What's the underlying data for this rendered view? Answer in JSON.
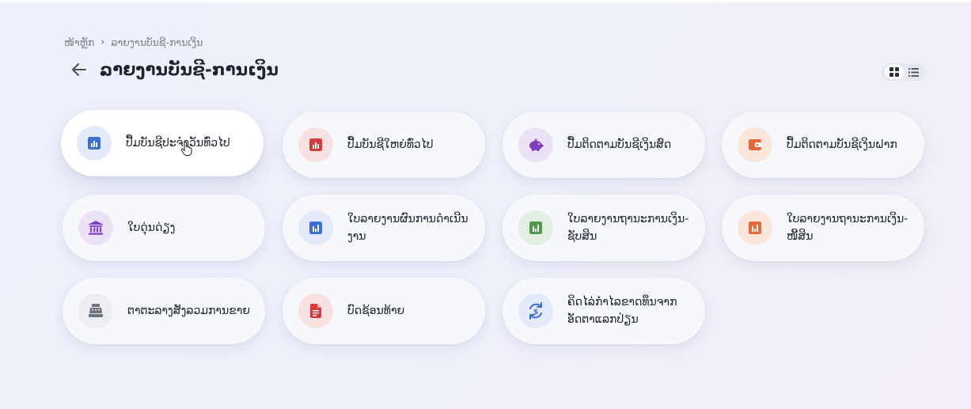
{
  "breadcrumb": {
    "home": "ໜ້າຫຼັກ",
    "current": "ລາຍງານບັນຊີ-ການເງິນ"
  },
  "page": {
    "title": "ລາຍງານບັນຊີ-ການເງິນ"
  },
  "cards": [
    {
      "label": "ປື້ມບັນຊີປະຈໍາວັນທົ່ວໄປ"
    },
    {
      "label": "ປື້ມບັນຊີໃຫຍ່ທົ່ວໄປ"
    },
    {
      "label": "ປື້ມຕິດຕາມບັນຊີເງິນສົດ"
    },
    {
      "label": "ປື້ມຕິດຕາມບັນຊີເງິນຝາກ"
    },
    {
      "label": "ໃບດຸ່ນດ່ຽງ"
    },
    {
      "label": "ໃບລາຍງານຜົນການດໍາເນີນງານ"
    },
    {
      "label": "ໃບລາຍງານຖານະການເງິນ-ຊັບສິນ"
    },
    {
      "label": "ໃບລາຍງານຖານະການເງິນ-ໜີ້ສິນ"
    },
    {
      "label": "ຕາຕະລາງສັງລວມການຂາຍ"
    },
    {
      "label": "ບົດຊ້ອນທ້າຍ"
    },
    {
      "label": "ຄິດໄລ່ກໍາໄລຂາດທຶນຈາກອັດຕາແລກປ່ຽນ"
    }
  ],
  "colors": {
    "blue": "#3a6fd8",
    "red": "#d63b3b",
    "purple": "#7b3fbf",
    "orange": "#e4683a",
    "green": "#4f9a4f",
    "gray": "#6c7280"
  }
}
